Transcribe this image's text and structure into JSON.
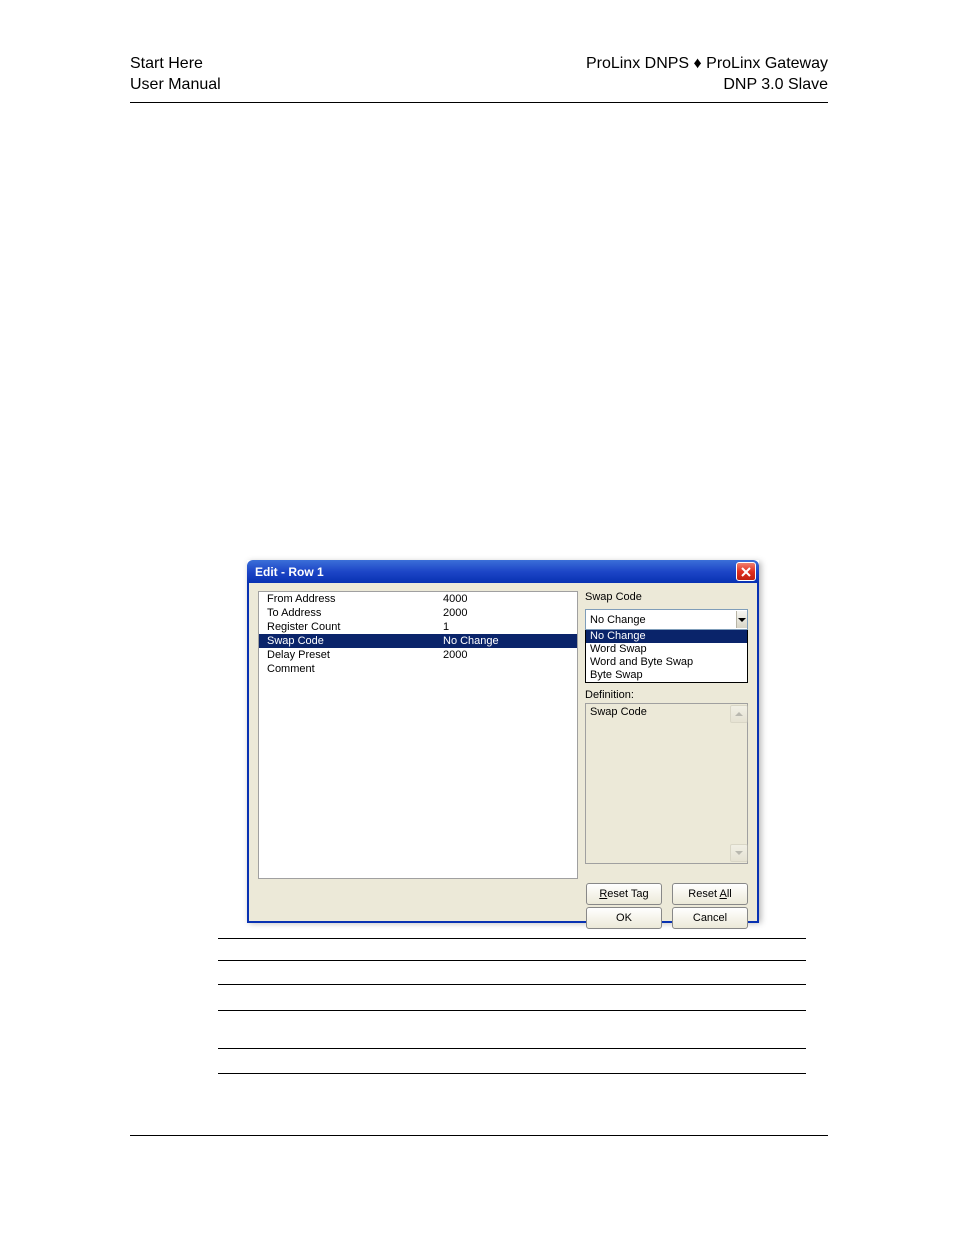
{
  "header": {
    "left_line1": "Start Here",
    "left_line2": "User Manual",
    "right_line1": "ProLinx DNPS ♦ ProLinx Gateway",
    "right_line2": "DNP 3.0 Slave"
  },
  "dialog": {
    "title": "Edit - Row 1",
    "rows": [
      {
        "label": "From Address",
        "value": "4000"
      },
      {
        "label": "To Address",
        "value": "2000"
      },
      {
        "label": "Register Count",
        "value": "1"
      },
      {
        "label": "Swap Code",
        "value": "No Change"
      },
      {
        "label": "Delay Preset",
        "value": "2000"
      },
      {
        "label": "Comment",
        "value": ""
      }
    ],
    "selected_row_index": 3,
    "right": {
      "label": "Swap Code",
      "value": "No Change",
      "options": [
        "No Change",
        "Word Swap",
        "Word and Byte Swap",
        "Byte Swap"
      ],
      "selected_option_index": 0,
      "definition_label": "Definition:",
      "definition_text": "Swap Code"
    },
    "buttons": {
      "reset_tag_prefix": "R",
      "reset_tag_rest": "eset Tag",
      "reset_all_prefix": "Reset ",
      "reset_all_ul": "A",
      "reset_all_rest": "ll",
      "ok": "OK",
      "cancel": "Cancel"
    }
  }
}
